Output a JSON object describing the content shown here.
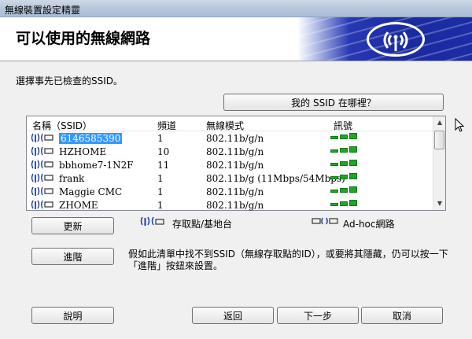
{
  "window": {
    "title": "無線裝置設定精靈"
  },
  "header": {
    "title": "可以使用的無線網路",
    "logo_icon": "wireless-signal-icon"
  },
  "prompt": "選擇事先已檢查的SSID。",
  "where_button": "我的 SSID 在哪裡？",
  "list": {
    "columns": [
      "名稱（SSID）",
      "頻道",
      "無線模式",
      "訊號"
    ],
    "rows": [
      {
        "ssid": "6146585390",
        "channel": "1",
        "mode": "802.11b/g/n",
        "signal": 3,
        "selected": true
      },
      {
        "ssid": "HZHOME",
        "channel": "10",
        "mode": "802.11b/g/n",
        "signal": 3,
        "selected": false
      },
      {
        "ssid": "bbhome7-1N2F",
        "channel": "11",
        "mode": "802.11b/g/n",
        "signal": 3,
        "selected": false
      },
      {
        "ssid": "frank",
        "channel": "1",
        "mode": "802.11b/g (11Mbps/54Mbps)",
        "signal": 3,
        "selected": false
      },
      {
        "ssid": "Maggie CMC",
        "channel": "1",
        "mode": "802.11b/g/n",
        "signal": 3,
        "selected": false
      },
      {
        "ssid": "ZHOME",
        "channel": "1",
        "mode": "802.11b/g/n",
        "signal": 3,
        "selected": false
      }
    ]
  },
  "refresh_button": "更新",
  "legend": {
    "access_point": "存取點/基地台",
    "adhoc": "Ad-hoc網路"
  },
  "advanced_button": "進階",
  "info_text": "假如此清單中找不到SSID（無線存取點的ID），或要將其隱藏，仍可以按一下「進階」按鈕來設置。",
  "buttons": {
    "help": "說明",
    "back": "返回",
    "next": "下一步",
    "cancel": "取消"
  },
  "colors": {
    "accent_blue": "#1f2fa8",
    "signal_green": "#22a32a",
    "selection": "#3399ff"
  }
}
